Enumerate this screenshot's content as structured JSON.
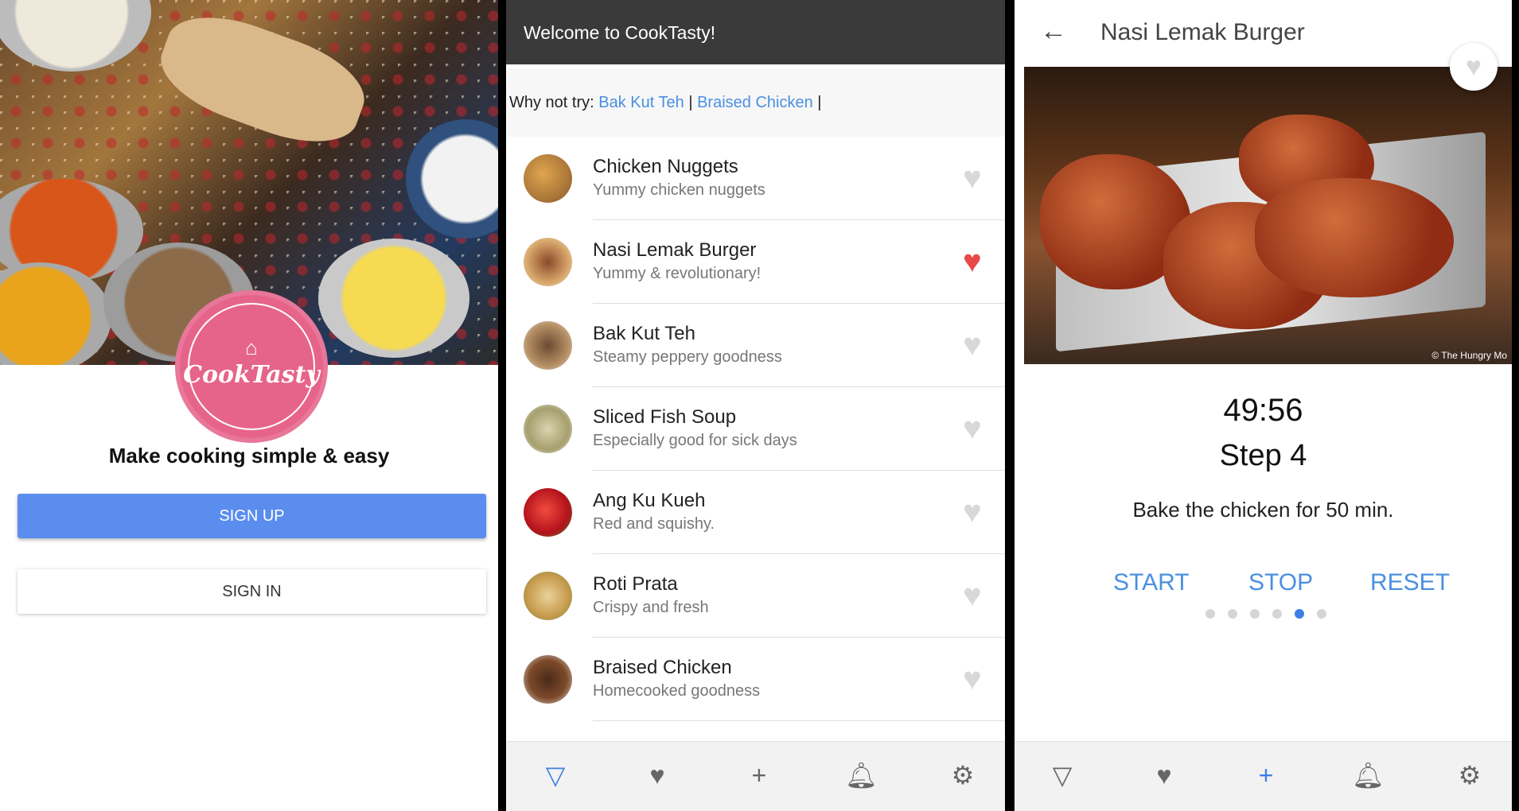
{
  "login": {
    "logo_text": "CookTasty",
    "tagline": "Make cooking simple & easy",
    "signup_label": "SIGN UP",
    "signin_label": "SIGN IN"
  },
  "home": {
    "appbar_title": "Welcome to CookTasty!",
    "suggest_prefix": "Why not try:",
    "suggestions": [
      "Bak Kut Teh",
      "Braised Chicken"
    ],
    "separator": "|",
    "recipes": [
      {
        "title": "Chicken Nuggets",
        "subtitle": "Yummy chicken nuggets",
        "favorite": false
      },
      {
        "title": "Nasi Lemak Burger",
        "subtitle": "Yummy & revolutionary!",
        "favorite": true
      },
      {
        "title": "Bak Kut Teh",
        "subtitle": "Steamy peppery goodness",
        "favorite": false
      },
      {
        "title": "Sliced Fish Soup",
        "subtitle": "Especially good for sick days",
        "favorite": false
      },
      {
        "title": "Ang Ku Kueh",
        "subtitle": "Red and squishy.",
        "favorite": false
      },
      {
        "title": "Roti Prata",
        "subtitle": "Crispy and fresh",
        "favorite": false
      },
      {
        "title": "Braised Chicken",
        "subtitle": "Homecooked goodness",
        "favorite": false
      }
    ],
    "nav": [
      {
        "icon": "pizza-icon",
        "active": true
      },
      {
        "icon": "heart-icon",
        "active": false
      },
      {
        "icon": "plus-icon",
        "active": false
      },
      {
        "icon": "bell-icon",
        "active": false
      },
      {
        "icon": "gear-icon",
        "active": false
      }
    ]
  },
  "detail": {
    "title": "Nasi Lemak Burger",
    "photo_credit": "© The Hungry Mo",
    "timer": "49:56",
    "step": "Step 4",
    "instruction": "Bake the chicken for 50 min.",
    "start_label": "START",
    "stop_label": "STOP",
    "reset_label": "RESET",
    "steps_total": 6,
    "current_step_index": 4,
    "nav": [
      {
        "icon": "pizza-icon",
        "active": false
      },
      {
        "icon": "heart-icon",
        "active": false
      },
      {
        "icon": "plus-icon",
        "active": true
      },
      {
        "icon": "bell-icon",
        "active": false
      },
      {
        "icon": "gear-icon",
        "active": false
      }
    ]
  },
  "colors": {
    "accent": "#4a8fe2",
    "signup": "#5b8def",
    "logo": "#e6648a",
    "heart_on": "#e84848",
    "heart_off": "#d8d8d8",
    "appbar": "#3a3a3a"
  }
}
